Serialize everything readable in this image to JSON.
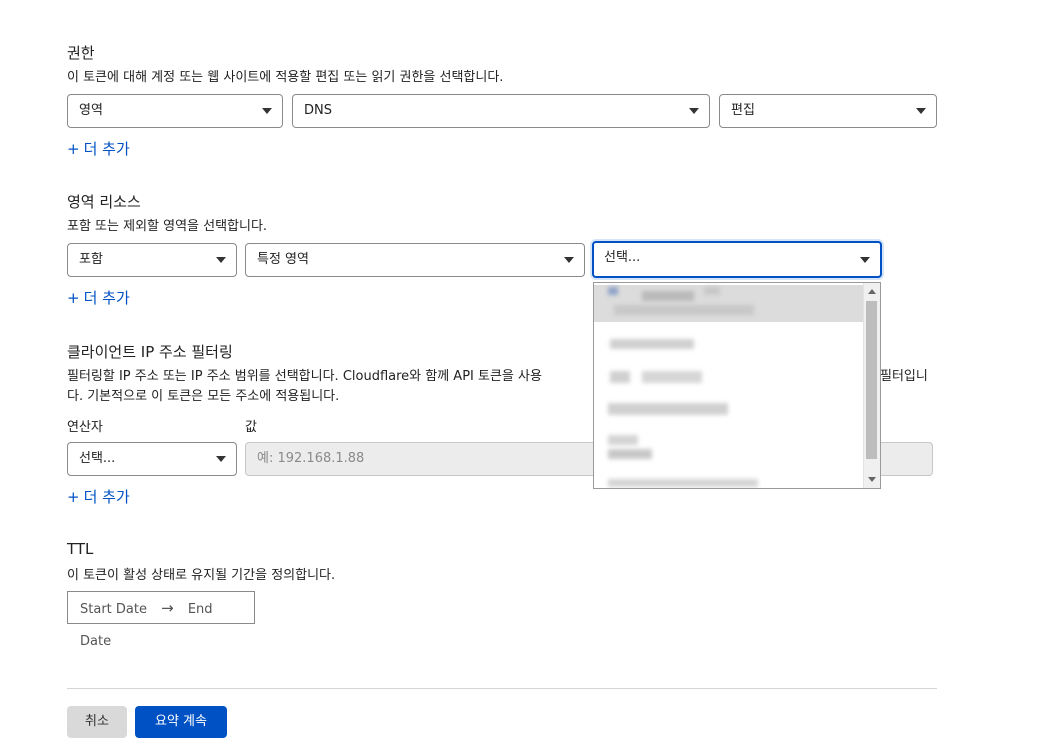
{
  "permissions": {
    "title": "권한",
    "description": "이 토큰에 대해 계정 또는 웹 사이트에 적용할 편집 또는 읽기 권한을 선택합니다.",
    "scope_select": "영역",
    "resource_select": "DNS",
    "permission_select": "편집",
    "add_more": "더 추가"
  },
  "zone_resources": {
    "title": "영역 리소스",
    "description": "포함 또는 제외할 영역을 선택합니다.",
    "include_select": "포함",
    "zone_type_select": "특정 영역",
    "zone_select_placeholder": "선택...",
    "add_more": "더 추가"
  },
  "ip_filtering": {
    "title": "클라이언트 IP 주소 필터링",
    "description_line1": "필터링할 IP 주소 또는 IP 주소 범위를 선택합니다. Cloudflare와 함께 API 토큰을 사용",
    "description_line1_tail": "필터입니",
    "description_line2": "다. 기본적으로 이 토큰은 모든 주소에 적용됩니다.",
    "operator_label": "연산자",
    "value_label": "값",
    "operator_select": "선택...",
    "value_placeholder": "예: 192.168.1.88",
    "add_more": "더 추가"
  },
  "ttl": {
    "title": "TTL",
    "description": "이 토큰이 활성 상태로 유지될 기간을 정의합니다.",
    "start_date": "Start Date",
    "end_date": "End Date"
  },
  "footer": {
    "cancel": "취소",
    "continue": "요약 계속"
  },
  "colors": {
    "accent": "#0051c3",
    "text": "#222222",
    "disabled_bg": "#ececec"
  }
}
